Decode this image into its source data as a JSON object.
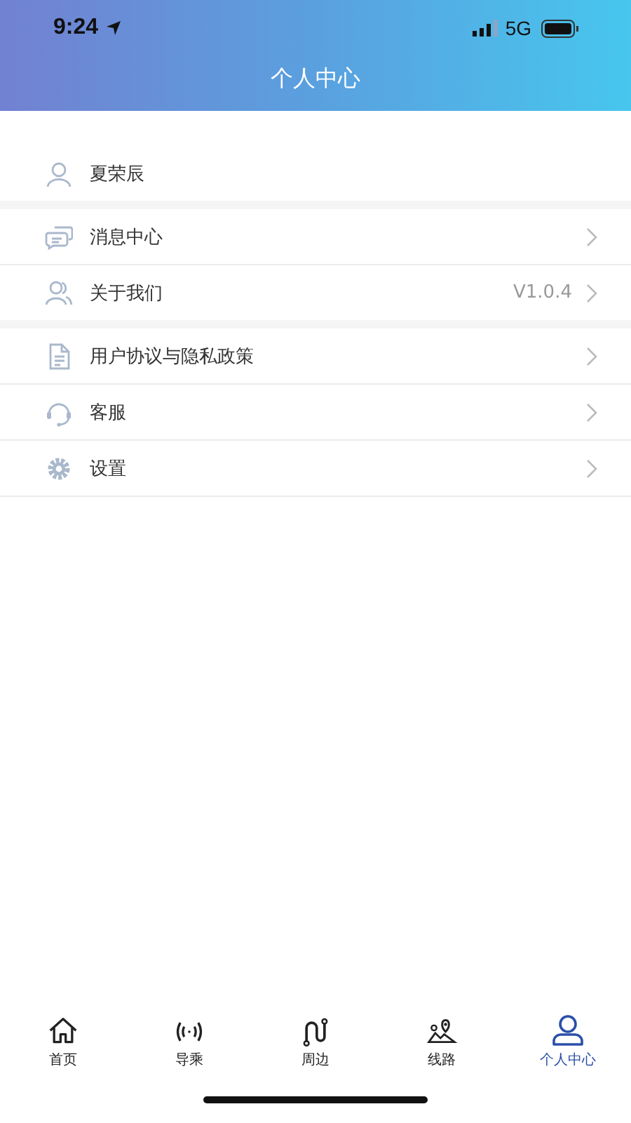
{
  "status_bar": {
    "time": "9:24",
    "network": "5G"
  },
  "header": {
    "title": "个人中心"
  },
  "sections": [
    {
      "items": [
        {
          "kind": "profile",
          "label": "夏荣辰"
        }
      ]
    },
    {
      "items": [
        {
          "kind": "link",
          "label": "消息中心"
        },
        {
          "kind": "link",
          "label": "关于我们",
          "value": "V1.0.4"
        }
      ]
    },
    {
      "items": [
        {
          "kind": "link",
          "label": "用户协议与隐私政策"
        },
        {
          "kind": "link",
          "label": "客服"
        },
        {
          "kind": "link",
          "label": "设置"
        }
      ]
    }
  ],
  "tabs": [
    {
      "label": "首页",
      "selected": false
    },
    {
      "label": "导乘",
      "selected": false
    },
    {
      "label": "周边",
      "selected": false
    },
    {
      "label": "线路",
      "selected": false
    },
    {
      "label": "个人中心",
      "selected": true
    }
  ]
}
